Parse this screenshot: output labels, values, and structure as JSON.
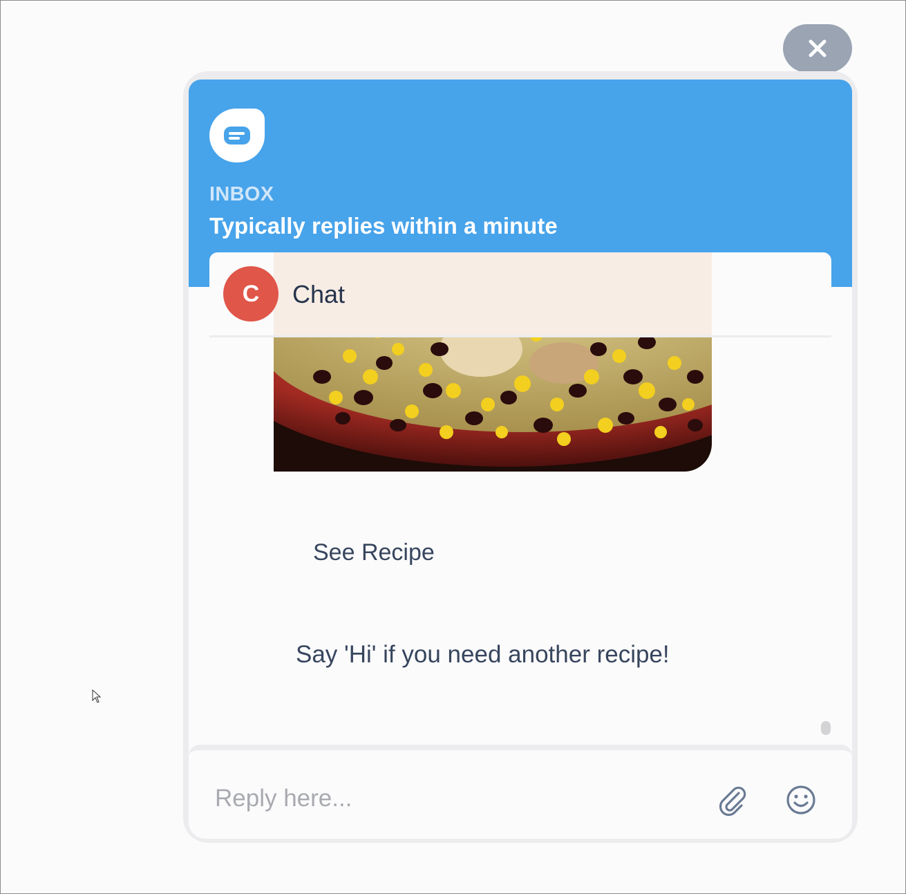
{
  "widget": {
    "close_icon": "close-icon",
    "logo_icon": "chat-bubble-icon",
    "inbox_label": "INBOX",
    "reply_time": "Typically replies within a minute",
    "accent_color": "#47a3ea"
  },
  "conversation": {
    "avatar_initial": "C",
    "avatar_color": "#e05649",
    "title": "Chat"
  },
  "messages": [
    {
      "type": "image",
      "alt": "rice-and-beans-dish"
    },
    {
      "type": "link",
      "text": "See Recipe"
    },
    {
      "type": "text",
      "text": "Say 'Hi' if you need another recipe!"
    }
  ],
  "composer": {
    "placeholder": "Reply here...",
    "value": "",
    "attach_icon": "paperclip-icon",
    "emoji_icon": "smiley-icon"
  }
}
